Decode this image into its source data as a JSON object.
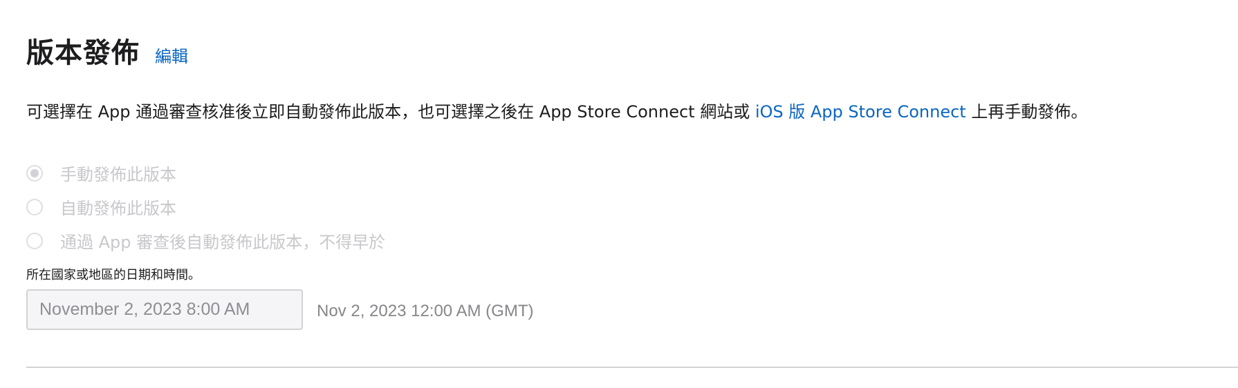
{
  "header": {
    "title": "版本發佈",
    "edit_label": "編輯"
  },
  "description": {
    "text_before": "可選擇在 App 通過審查核准後立即自動發佈此版本，也可選擇之後在 App Store Connect 網站或 ",
    "link_text": "iOS 版 App Store Connect",
    "text_after": " 上再手動發佈。"
  },
  "release_options": [
    {
      "label": "手動發佈此版本",
      "selected": true
    },
    {
      "label": "自動發佈此版本",
      "selected": false
    },
    {
      "label": "通過 App 審查後自動發佈此版本，不得早於",
      "selected": false
    }
  ],
  "date_note": "所在國家或地區的日期和時間。",
  "date_input": {
    "value": "November 2, 2023 8:00 AM"
  },
  "gmt_time": "Nov 2, 2023 12:00 AM (GMT)",
  "colors": {
    "link": "#0a66c2",
    "text": "#1d1d1f",
    "disabled_text": "#c8c8cc",
    "divider": "#d2d2d7"
  }
}
